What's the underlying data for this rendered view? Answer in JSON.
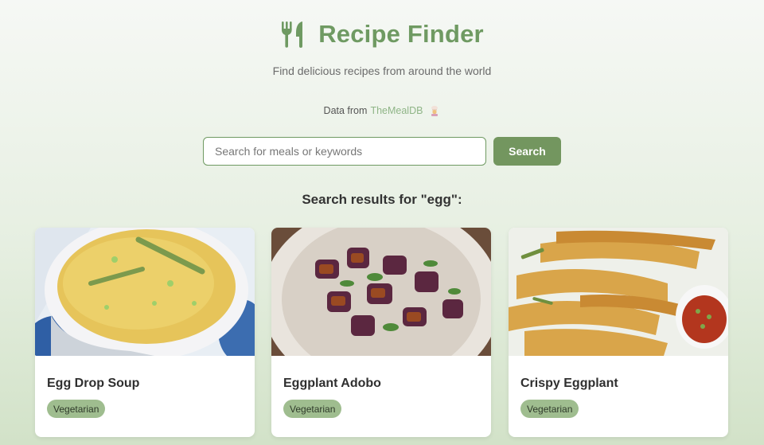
{
  "header": {
    "title": "Recipe Finder",
    "subtitle": "Find delicious recipes from around the world",
    "logo_icon": "fork-knife-icon"
  },
  "credit": {
    "prefix": "Data from",
    "link_text": "TheMealDB",
    "emoji_icon": "chef-emoji-icon"
  },
  "search": {
    "placeholder": "Search for meals or keywords",
    "value": "",
    "button_label": "Search"
  },
  "results": {
    "heading": "Search results for \"egg\":",
    "items": [
      {
        "title": "Egg Drop Soup",
        "tag": "Vegetarian",
        "image": "egg-drop-soup-photo"
      },
      {
        "title": "Eggplant Adobo",
        "tag": "Vegetarian",
        "image": "eggplant-adobo-photo"
      },
      {
        "title": "Crispy Eggplant",
        "tag": "Vegetarian",
        "image": "crispy-eggplant-photo"
      }
    ]
  },
  "colors": {
    "accent": "#6f9a62",
    "button": "#73965f",
    "tag_bg": "#9fbd8f",
    "link": "#8fb587"
  }
}
